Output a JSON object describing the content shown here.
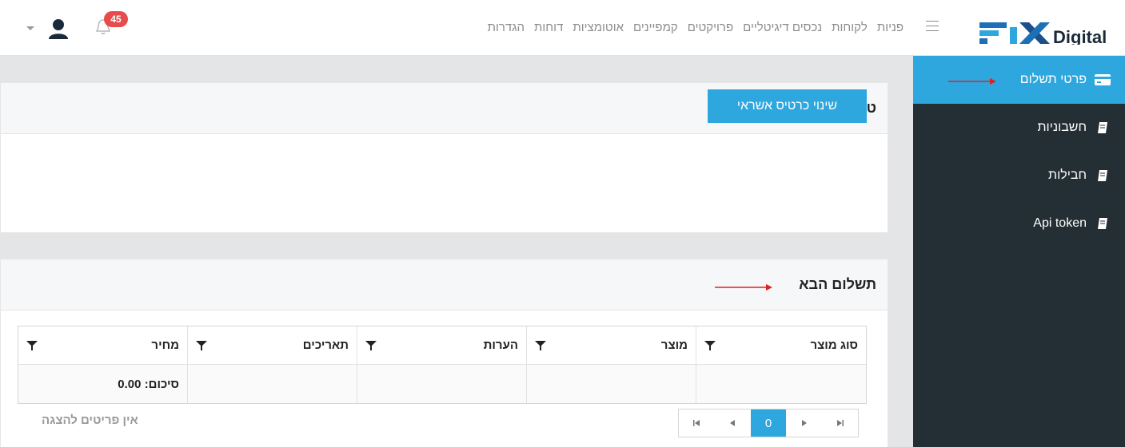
{
  "header": {
    "logo_text": "FIX Digital",
    "nav": [
      "פניות",
      "לקוחות",
      "נכסים דיגיטליים",
      "פרויקטים",
      "קמפיינים",
      "אוטומציות",
      "דוחות",
      "הגדרות"
    ],
    "notifications_count": "45"
  },
  "sidebar": {
    "items": [
      {
        "label": "פרטי תשלום",
        "icon": "credit-card-icon",
        "active": true
      },
      {
        "label": "חשבוניות",
        "icon": "book-icon",
        "active": false
      },
      {
        "label": "חבילות",
        "icon": "book-icon",
        "active": false
      },
      {
        "label": "Api token",
        "icon": "book-icon",
        "active": false
      }
    ]
  },
  "token_panel": {
    "title": "טוקן לא הוגדר",
    "change_card_button": "שינוי כרטיס אשראי"
  },
  "next_payment": {
    "title": "תשלום הבא",
    "columns": [
      "סוג מוצר",
      "מוצר",
      "הערות",
      "תאריכים",
      "מחיר"
    ],
    "summary": "סיכום: 0.00",
    "pager_current": "0",
    "empty_text": "אין פריטים להצגה"
  },
  "colors": {
    "accent": "#2ea7df",
    "sidebar_bg": "#232e35",
    "badge": "#e84b4b",
    "arrow": "#e02020"
  }
}
